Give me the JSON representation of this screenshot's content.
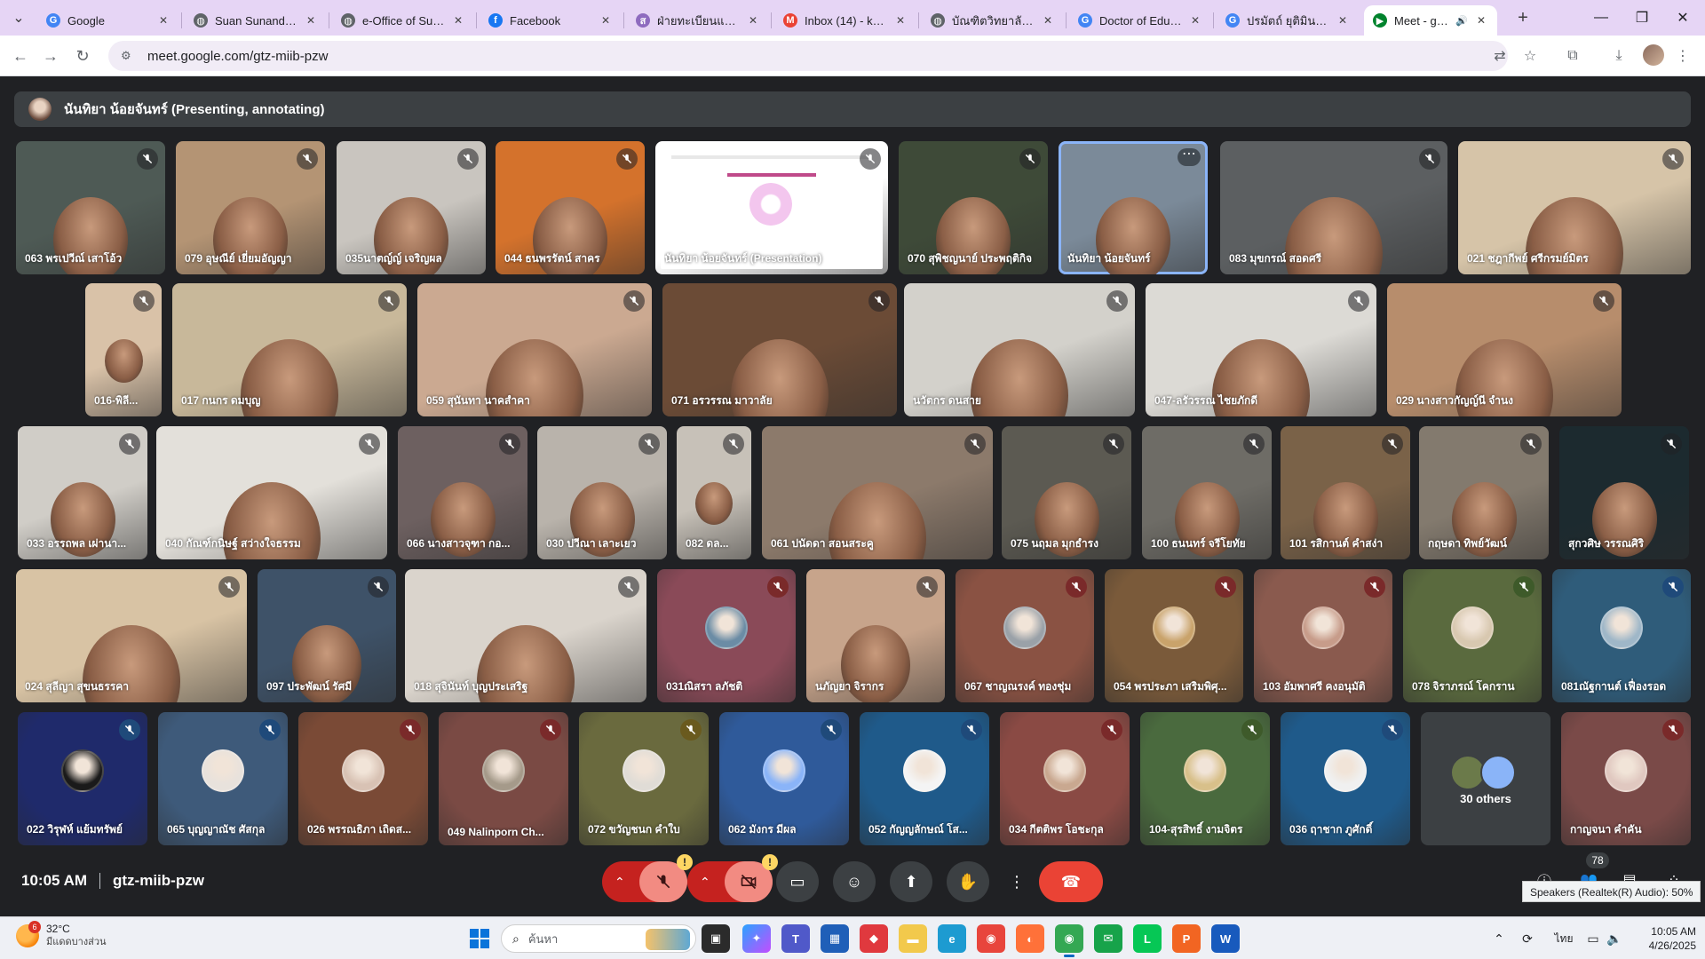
{
  "browser": {
    "tabs": [
      {
        "title": "Google",
        "favicon": "google-g-icon",
        "color": "#4285f4",
        "glyph": "G",
        "active": false
      },
      {
        "title": "Suan Sunandha R",
        "favicon": "globe-icon",
        "color": "#5f6368",
        "glyph": "◍",
        "active": false
      },
      {
        "title": "e-Office of Suan S",
        "favicon": "globe-icon",
        "color": "#5f6368",
        "glyph": "◍",
        "active": false
      },
      {
        "title": "Facebook",
        "favicon": "facebook-icon",
        "color": "#1877f2",
        "glyph": "f",
        "active": false
      },
      {
        "title": "ฝ่ายทะเบียนและประเ",
        "favicon": "ssru-logo-icon",
        "color": "#8e6bbf",
        "glyph": "ส",
        "active": false
      },
      {
        "title": "Inbox (14) - kanja",
        "favicon": "gmail-icon",
        "color": "#ea4335",
        "glyph": "M",
        "active": false
      },
      {
        "title": "บัณฑิตวิทยาลัย มหา",
        "favicon": "globe-icon",
        "color": "#5f6368",
        "glyph": "◍",
        "active": false
      },
      {
        "title": "Doctor of Educatio",
        "favicon": "google-g-icon",
        "color": "#4285f4",
        "glyph": "G",
        "active": false
      },
      {
        "title": "ปรมัตถ์ ยุติมินต์ - ค้น",
        "favicon": "google-g-icon",
        "color": "#4285f4",
        "glyph": "G",
        "active": false
      },
      {
        "title": "Meet - gtz-mi",
        "favicon": "meet-icon",
        "color": "#00832d",
        "glyph": "▶",
        "active": true
      }
    ],
    "url": "meet.google.com/gtz-miib-pzw"
  },
  "meet": {
    "presenter_banner": "นันทิยา น้อยจันทร์ (Presenting, annotating)",
    "participants": [
      {
        "name": "063 พรเปวีณ์ เสาโอ้ว",
        "bg": "#4e5a55",
        "mic": "muted-grey"
      },
      {
        "name": "079 อุษณีย์ เยี่ยมอัญญา",
        "bg": "#b49474",
        "mic": "muted-grey"
      },
      {
        "name": "035นาตญ์ญ์ เจริญผล",
        "bg": "#c9c5bf",
        "mic": "muted-grey"
      },
      {
        "name": "044 ธนพรรัตน์ สาคร",
        "bg": "#d4722c",
        "mic": "muted-grey"
      },
      {
        "name": "นันทิยา น้อยจันทร์ (Presentation)",
        "bg": "#ffffff",
        "mic": "muted-grey",
        "slide": true
      },
      {
        "name": "070 สุพิชญนาย์ ประพฤติกิจ",
        "bg": "#3e4a38",
        "mic": "muted-grey"
      },
      {
        "name": "นันทิยา น้อยจันทร์",
        "bg": "#7b8a99",
        "mic": "more",
        "speaking": true
      },
      {
        "name": "083 มุขกรณ์ สอดศรี",
        "bg": "#5c5f61",
        "mic": "muted-grey"
      },
      {
        "name": "021 ชฎากีพย์ ศรีกรมย์มิตร",
        "bg": "#d6c4a8",
        "mic": "muted-grey"
      },
      {
        "name": "016-พิลี...",
        "bg": "#d9c2a8",
        "mic": "muted-grey"
      },
      {
        "name": "017 กนกร ดมบุญ",
        "bg": "#c8b89a",
        "mic": "muted-grey"
      },
      {
        "name": "059 สุนันทา นาคสำคา",
        "bg": "#cba991",
        "mic": "muted-grey"
      },
      {
        "name": "071 อรวรรณ มาวาลัย",
        "bg": "#6b4b36",
        "mic": "muted-grey"
      },
      {
        "name": "นวัตกร ดนสาย",
        "bg": "#d3d1cb",
        "mic": "muted-grey"
      },
      {
        "name": "047-ลรัวรรณ ไชยภักดี",
        "bg": "#dcdad5",
        "mic": "muted-grey"
      },
      {
        "name": "029 นางสาวกัญญ์นี จำนง",
        "bg": "#b78d6c",
        "mic": "muted-grey"
      },
      {
        "name": "033 อรรถพล เผ่านา...",
        "bg": "#d0cdc7",
        "mic": "muted-grey"
      },
      {
        "name": "040 กัณฑ์กนิษฐ์ สว่างใจธรรม",
        "bg": "#e3e0da",
        "mic": "muted-grey"
      },
      {
        "name": "066 นางสาวจุฑา กอ...",
        "bg": "#6d6060",
        "mic": "muted-grey"
      },
      {
        "name": "030 ปวีณา เลาะเยว",
        "bg": "#b9b3ab",
        "mic": "muted-grey"
      },
      {
        "name": "082 ดล...",
        "bg": "#c7c1b8",
        "mic": "muted-grey"
      },
      {
        "name": "061 ปนัดดา สอนสระคู",
        "bg": "#8c7a6b",
        "mic": "muted-grey"
      },
      {
        "name": "075 นฤมล มุกธำรง",
        "bg": "#5c5a52",
        "mic": "muted-grey"
      },
      {
        "name": "100 ธนนทร์ จรีโยทัย",
        "bg": "#6e6c66",
        "mic": "muted-grey"
      },
      {
        "name": "101 รสิกานต์ คำสง่า",
        "bg": "#7a6248",
        "mic": "muted-grey"
      },
      {
        "name": "กฤษดา ทิพย์วัฒน์",
        "bg": "#837a6e",
        "mic": "muted-grey"
      },
      {
        "name": "สุกวศิษ วรรณศิริ",
        "bg": "#1c2a2f",
        "mic": "muted-grey"
      },
      {
        "name": "024 สุลีญา สุขนธรรคา",
        "bg": "#d8c3a4",
        "mic": "muted-grey"
      },
      {
        "name": "097 ประพัฒน์ รัศมี",
        "bg": "#3e5268",
        "mic": "muted-grey"
      },
      {
        "name": "018 สุจินันท์ บุญประเสริฐ",
        "bg": "#dad4cc",
        "mic": "muted-grey"
      },
      {
        "name": "031ณิสรา ลภัชติ",
        "bg": "#8a4a58",
        "mic": "muted-red",
        "avatar": "#6b8ca5"
      },
      {
        "name": "นภัญยา จิรากร",
        "bg": "#c7a48b",
        "mic": "muted-grey"
      },
      {
        "name": "067 ชาญณรงค์ ทองชุ่ม",
        "bg": "#8a5243",
        "mic": "muted-red",
        "avatar": "#9aa1a8"
      },
      {
        "name": "054 พรประภา เสริมพิศุ...",
        "bg": "#7a5a3a",
        "mic": "muted-red",
        "avatar": "#c9a36b"
      },
      {
        "name": "103 อัมพาศรี คงอนุมัติ",
        "bg": "#8a5a4e",
        "mic": "muted-red",
        "avatar": "#c79c8a"
      },
      {
        "name": "078 จิราภรณ์ โคกราน",
        "bg": "#5a6a3e",
        "mic": "muted-green",
        "avatar": "#d8c8b0"
      },
      {
        "name": "081ณัฐกานต์ เฟื่องรอด",
        "bg": "#2f5c7a",
        "mic": "muted-blue",
        "avatar": "#9fb7c8"
      },
      {
        "name": "022 วิรุฬห์ แย้มทรัพย์",
        "bg": "#1f2a6b",
        "mic": "muted-blue",
        "avatar": "#1a1a1a"
      },
      {
        "name": "065 บุญญาณัช ศัสกุล",
        "bg": "#3e5a7a",
        "mic": "muted-blue",
        "avatar": "#e8e2dc"
      },
      {
        "name": "026 พรรณธิภา เถิดส...",
        "bg": "#7a4a36",
        "mic": "muted-red",
        "avatar": "#d8c2b4"
      },
      {
        "name": "049 Nalinporn Ch...",
        "bg": "#7a4a44",
        "mic": "muted-red",
        "avatar": "#a59a8a"
      },
      {
        "name": "072 ขวัญชนก คำใบ",
        "bg": "#6a6a3e",
        "mic": "muted-yellow",
        "avatar": "#e0dcd6"
      },
      {
        "name": "062 มังกร มีผล",
        "bg": "#2f5a9a",
        "mic": "muted-blue",
        "avatar": "#8ab4f8"
      },
      {
        "name": "052 กัญญลักษณ์ โส...",
        "bg": "#1f5a8a",
        "mic": "muted-blue",
        "avatar": "#f4f4f4"
      },
      {
        "name": "034 กีตติพร โอชะกุล",
        "bg": "#8a4a44",
        "mic": "muted-red",
        "avatar": "#c9a890"
      },
      {
        "name": "104-สุรสิทธิ์ งามจิตร",
        "bg": "#4a6a3e",
        "mic": "muted-green",
        "avatar": "#d8c08a"
      },
      {
        "name": "036 ฤาชาก ภูศักดิ์",
        "bg": "#1f5a8a",
        "mic": "muted-blue",
        "avatar": "#f0f0f0"
      },
      {
        "name": "30 others",
        "bg": "#3c4043",
        "mic": "none",
        "others": true
      },
      {
        "name": "กาญจนา คำคัน",
        "bg": "#7a4a48",
        "mic": "muted-red",
        "avatar": "#e0c8c0"
      }
    ],
    "footer": {
      "time": "10:05 AM",
      "meeting_code": "gtz-miib-pzw",
      "participant_count": "78",
      "speakers_tooltip": "Speakers (Realtek(R) Audio): 50%",
      "warn_glyph": "!"
    }
  },
  "taskbar": {
    "weather_temp": "32°C",
    "weather_desc": "มีแดดบางส่วน",
    "weather_badge": "6",
    "search_placeholder": "ค้นหา",
    "lang": "ไทย",
    "clock_time": "10:05 AM",
    "clock_date": "4/26/2025"
  }
}
